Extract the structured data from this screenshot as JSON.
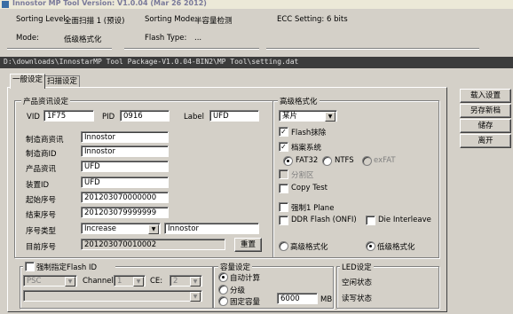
{
  "title": "Innostor MP Tool Version: V1.0.04 (Mar 26 2012)",
  "status": {
    "sorting_level_label": "Sorting Level:",
    "sorting_level_value": "全面扫描 1 (预设)",
    "sorting_mode_label": "Sorting Mode:",
    "sorting_mode_value": "半容量检测",
    "ecc_label": "ECC Setting:",
    "ecc_value": "6 bits",
    "mode_label": "Mode:",
    "mode_value": "低级格式化",
    "flash_type_label": "Flash Type:",
    "flash_type_value": "..."
  },
  "path": "D:\\downloads\\InnostarMP Tool Package-V1.0.04-BIN2\\MP Tool\\setting.dat",
  "tabs": [
    {
      "label": "一般设定",
      "active": true
    },
    {
      "label": "扫描设定",
      "active": false
    }
  ],
  "product": {
    "legend": "产品资讯设定",
    "vid_label": "VID",
    "vid": "1F75",
    "pid_label": "PID",
    "pid": "0916",
    "label_label": "Label",
    "label": "UFD",
    "rows": [
      {
        "label": "制造商资讯",
        "value": "Innostor"
      },
      {
        "label": "制造商ID",
        "value": "Innostor"
      },
      {
        "label": "产品资讯",
        "value": "UFD"
      },
      {
        "label": "装置ID",
        "value": "UFD"
      },
      {
        "label": "起始序号",
        "value": "201203070000000"
      },
      {
        "label": "结束序号",
        "value": "201203079999999"
      }
    ],
    "serial_type_label": "序号类型",
    "serial_type": "Increase",
    "serial_type_extra": "Innostor",
    "current_serial_label": "目前序号",
    "current_serial": "201203070010002",
    "reset_button": "重置"
  },
  "format": {
    "legend": "高级格式化",
    "combo": "某片",
    "flash_erase": "Flash抹除",
    "filesystem": "档案系统",
    "fat32": "FAT32",
    "ntfs": "NTFS",
    "exfat": "exFAT",
    "partition": "分割区",
    "copy_test": "Copy Test",
    "force_plane": "强制1 Plane",
    "ddr_flash": "DDR Flash (ONFI)",
    "die_interleave": "Die Interleave",
    "high_format": "高级格式化",
    "low_format": "低级格式化"
  },
  "flashid": {
    "label": "强制指定Flash ID",
    "combo1": "PSC",
    "channel_label": "Channel:",
    "channel": "1",
    "ce_label": "CE:",
    "ce": "2"
  },
  "capacity": {
    "legend": "容量设定",
    "auto": "自动计算",
    "grade": "分级",
    "fixed": "固定容量",
    "fixed_value": "6000",
    "unit": "MB"
  },
  "led": {
    "legend": "LED设定",
    "idle": "空闲状态",
    "rw": "读写状态"
  },
  "buttons": {
    "load": "载入设置",
    "save_as": "另存新档",
    "save": "储存",
    "leave": "离开"
  }
}
